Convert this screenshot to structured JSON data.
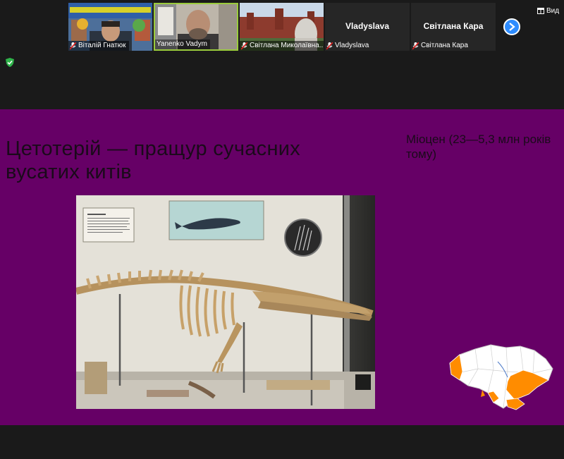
{
  "participants": [
    {
      "name": "Віталій Гнатюк",
      "video": true
    },
    {
      "name": "Yanenko Vadym",
      "video": true,
      "active": true
    },
    {
      "name": "Світлана Миколаївна...",
      "video": true
    },
    {
      "name": "Vladyslava",
      "video": false
    },
    {
      "name": "Світлана Кара",
      "video": false
    }
  ],
  "header": {
    "view_label": "Вид",
    "next_icon": "chevron-right-icon",
    "security_icon": "shield-check-icon"
  },
  "slide": {
    "title": "Цетотерій — пращур сучасних вусатих китів",
    "subtitle": "Міоцен (23—5,3 млн років тому)",
    "background": "#660066",
    "map_highlight_color": "#ff8c00"
  },
  "colors": {
    "accent_blue": "#2d8cff",
    "active_speaker": "#9acb3c",
    "mute_red": "#e02020"
  }
}
